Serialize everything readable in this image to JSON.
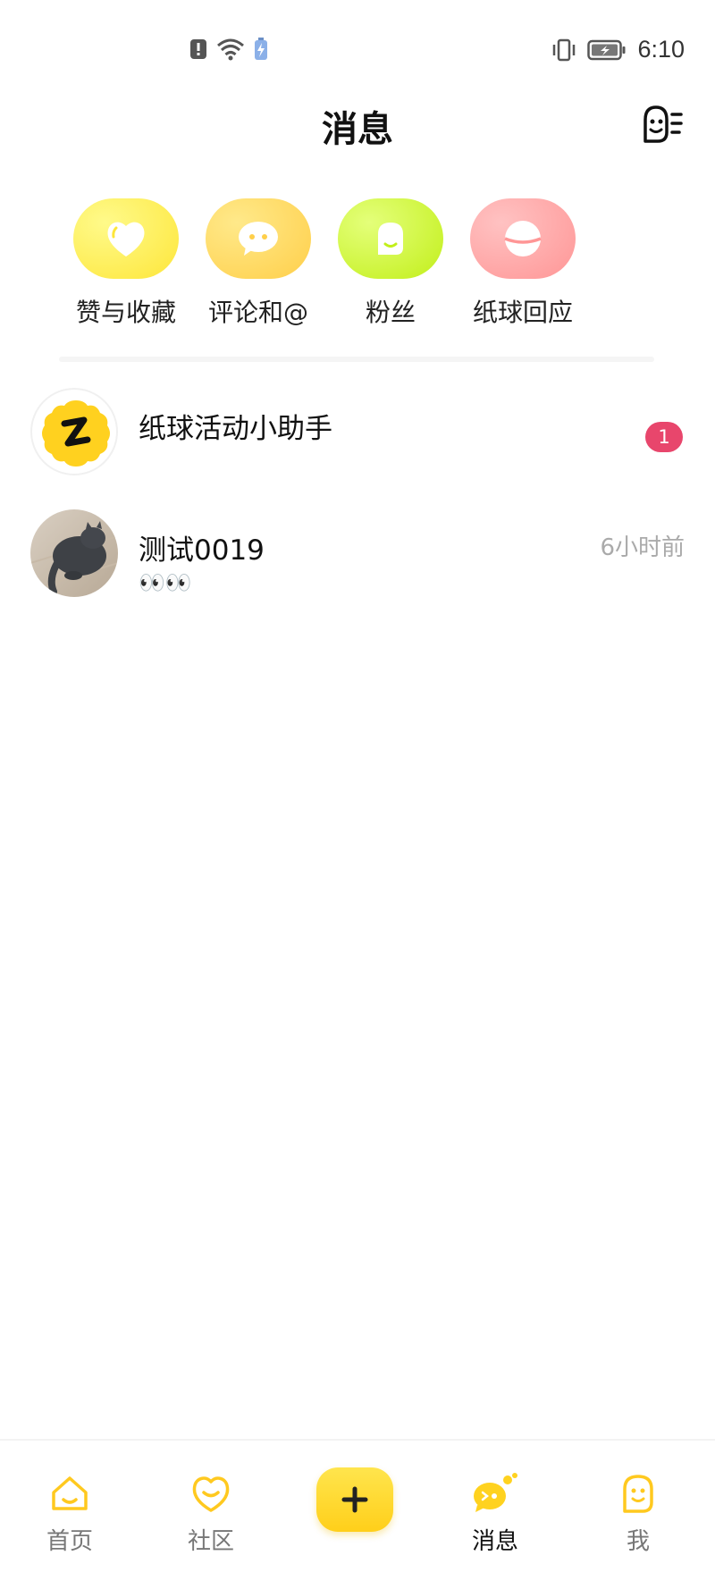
{
  "status_bar": {
    "time": "6:10",
    "icons": [
      "alert-icon",
      "wifi-icon",
      "battery-saver-icon",
      "vibrate-icon",
      "battery-icon"
    ]
  },
  "header": {
    "title": "消息",
    "contacts_icon": "contacts-icon"
  },
  "categories": [
    {
      "label": "赞与收藏",
      "icon": "heart-icon",
      "color": "#fff04d"
    },
    {
      "label": "评论和@",
      "icon": "comment-icon",
      "color": "#ffd84d"
    },
    {
      "label": "粉丝",
      "icon": "fan-icon",
      "color": "#ccf52a"
    },
    {
      "label": "纸球回应",
      "icon": "paperball-icon",
      "color": "#ff9d9d"
    }
  ],
  "conversations": [
    {
      "name": "纸球活动小助手",
      "badge": "1",
      "avatar": "paperball-logo"
    },
    {
      "name": "测试0019",
      "preview": "👀👀",
      "time": "6小时前",
      "avatar": "cat-photo"
    }
  ],
  "bottom_nav": [
    {
      "label": "首页",
      "icon": "home-icon"
    },
    {
      "label": "社区",
      "icon": "community-icon"
    },
    {
      "label": "",
      "icon": "plus-icon"
    },
    {
      "label": "消息",
      "icon": "message-icon",
      "active": true
    },
    {
      "label": "我",
      "icon": "profile-icon"
    }
  ],
  "colors": {
    "accent": "#ffd21f",
    "badge": "#e8466c",
    "muted_text": "#aaaaaa"
  }
}
